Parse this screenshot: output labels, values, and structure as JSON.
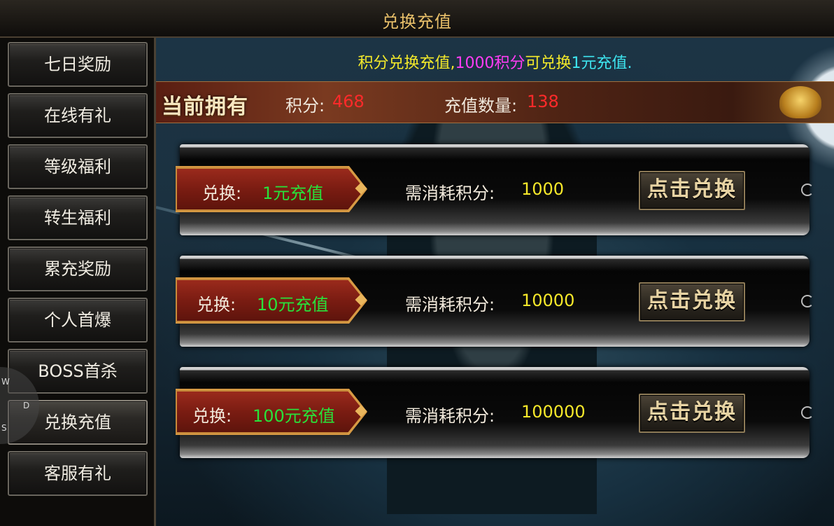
{
  "window": {
    "title": "兑换充值"
  },
  "sidebar": {
    "items": [
      {
        "label": "七日奖励"
      },
      {
        "label": "在线有礼"
      },
      {
        "label": "等级福利"
      },
      {
        "label": "转生福利"
      },
      {
        "label": "累充奖励"
      },
      {
        "label": "个人首爆"
      },
      {
        "label": "BOSS首杀"
      },
      {
        "label": "兑换充值",
        "active": true
      },
      {
        "label": "客服有礼"
      }
    ],
    "ghost_letters": [
      "W",
      "D",
      "S"
    ]
  },
  "info": {
    "part1": "积分兑换充值,",
    "part2": "1000积分",
    "part3": "可兑换",
    "part4": "1元充值.",
    "colors": {
      "yellow": "#f4ea2a",
      "magenta": "#ff3cf4",
      "cyan": "#3ee6f0"
    }
  },
  "current": {
    "label": "当前拥有",
    "points_label": "积分:",
    "points_value": "468",
    "recharge_label": "充值数量:",
    "recharge_value": "138"
  },
  "exchanges": [
    {
      "tag_label": "兑换:",
      "amount": "1元充值",
      "cost_label": "需消耗积分:",
      "cost": "1000",
      "button": "点击兑换"
    },
    {
      "tag_label": "兑换:",
      "amount": "10元充值",
      "cost_label": "需消耗积分:",
      "cost": "10000",
      "button": "点击兑换"
    },
    {
      "tag_label": "兑换:",
      "amount": "100元充值",
      "cost_label": "需消耗积分:",
      "cost": "100000",
      "button": "点击兑换"
    }
  ]
}
